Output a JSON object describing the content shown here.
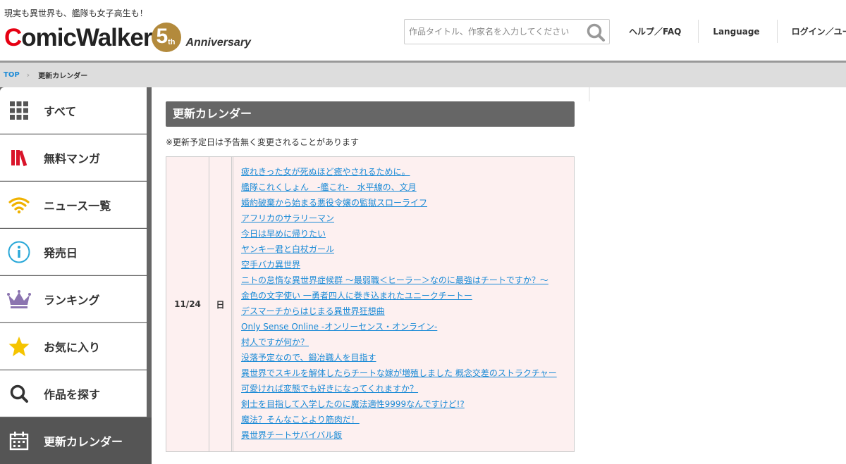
{
  "header": {
    "tagline": "現実も異世界も、艦隊も女子高生も！",
    "logo": {
      "text_part1": "C",
      "text_part2": "omicWalker",
      "anniv_number": "5",
      "anniv_suffix": "th",
      "anniv_word": "Anniversary"
    },
    "search": {
      "placeholder": "作品タイトル、作家名を入力してください",
      "value": ""
    },
    "links": [
      "ヘルプ／FAQ",
      "Language",
      "ログイン／ユー"
    ]
  },
  "breadcrumb": {
    "top": "TOP",
    "current": "更新カレンダー"
  },
  "sidebar": {
    "items": [
      {
        "label": "すべて",
        "icon": "grid-icon"
      },
      {
        "label": "無料マンガ",
        "icon": "books-icon"
      },
      {
        "label": "ニュース一覧",
        "icon": "wifi-icon"
      },
      {
        "label": "発売日",
        "icon": "info-icon"
      },
      {
        "label": "ランキング",
        "icon": "crown-icon"
      },
      {
        "label": "お気に入り",
        "icon": "star-icon"
      },
      {
        "label": "作品を探す",
        "icon": "search-icon"
      },
      {
        "label": "更新カレンダー",
        "icon": "calendar-icon",
        "active": true
      }
    ]
  },
  "main": {
    "title": "更新カレンダー",
    "note": "※更新予定日は予告無く変更されることがあります",
    "calendar": {
      "date": "11/24",
      "weekday": "日",
      "titles": [
        "疲れきった女が死ぬほど癒やされるために。",
        "艦隊これくしょん　-艦これ-　水平線の、文月",
        "婚約破棄から始まる悪役令嬢の監獄スローライフ",
        "アフリカのサラリーマン",
        "今日は早めに帰りたい",
        "ヤンキー君と白杖ガール",
        "空手バカ異世界",
        "ニトの怠惰な異世界症候群 ～最弱職＜ヒーラー＞なのに最強はチートですか？～",
        "金色の文字使い 一勇者四人に巻き込まれたユニークチートー",
        "デスマーチからはじまる異世界狂想曲",
        "Only Sense Online -オンリーセンス・オンライン-",
        "村人ですが何か？",
        "没落予定なので、鍛冶職人を目指す",
        "異世界でスキルを解体したらチートな嫁が増殖しました 概念交差のストラクチャー",
        "可愛ければ変態でも好きになってくれますか？",
        "剣士を目指して入学したのに魔法適性9999なんですけど!?",
        "魔法？そんなことより筋肉だ！",
        "異世界チートサバイバル飯"
      ]
    }
  },
  "colors": {
    "brand_red": "#e60012",
    "anniv_gold": "#b38a3c",
    "link_blue": "#1a8ad6",
    "calendar_bg": "#fdf0f0",
    "sidebar_bg": "#666666"
  }
}
